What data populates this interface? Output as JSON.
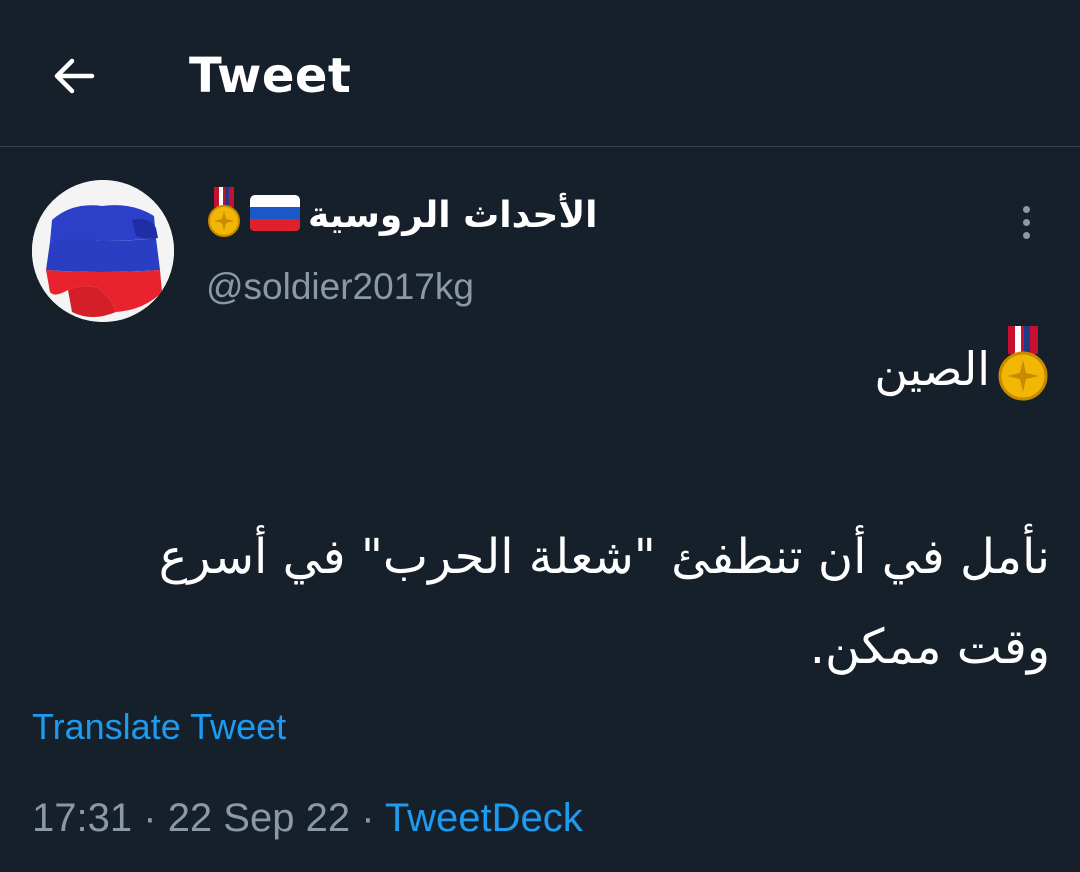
{
  "header": {
    "title": "Tweet",
    "back_icon": "arrow-left-icon"
  },
  "tweet": {
    "author": {
      "display_name": "الأحداث الروسية",
      "name_emojis": [
        "russia-flag-icon",
        "military-medal-icon"
      ],
      "handle": "@soldier2017kg",
      "avatar": "russian-flag-soldier-silhouette"
    },
    "line1_text": "الصين",
    "line1_emoji": "military-medal-icon",
    "body_text": "نأمل في أن تنطفئ \"شعلة الحرب\" في أسرع وقت ممكن.",
    "translate_label": "Translate Tweet",
    "time": "17:31",
    "date": "22 Sep 22",
    "separator": "·",
    "source": "TweetDeck"
  },
  "colors": {
    "background": "#15202b",
    "border": "#38444d",
    "secondary_text": "#8b98a5",
    "accent": "#1d9bf0"
  }
}
